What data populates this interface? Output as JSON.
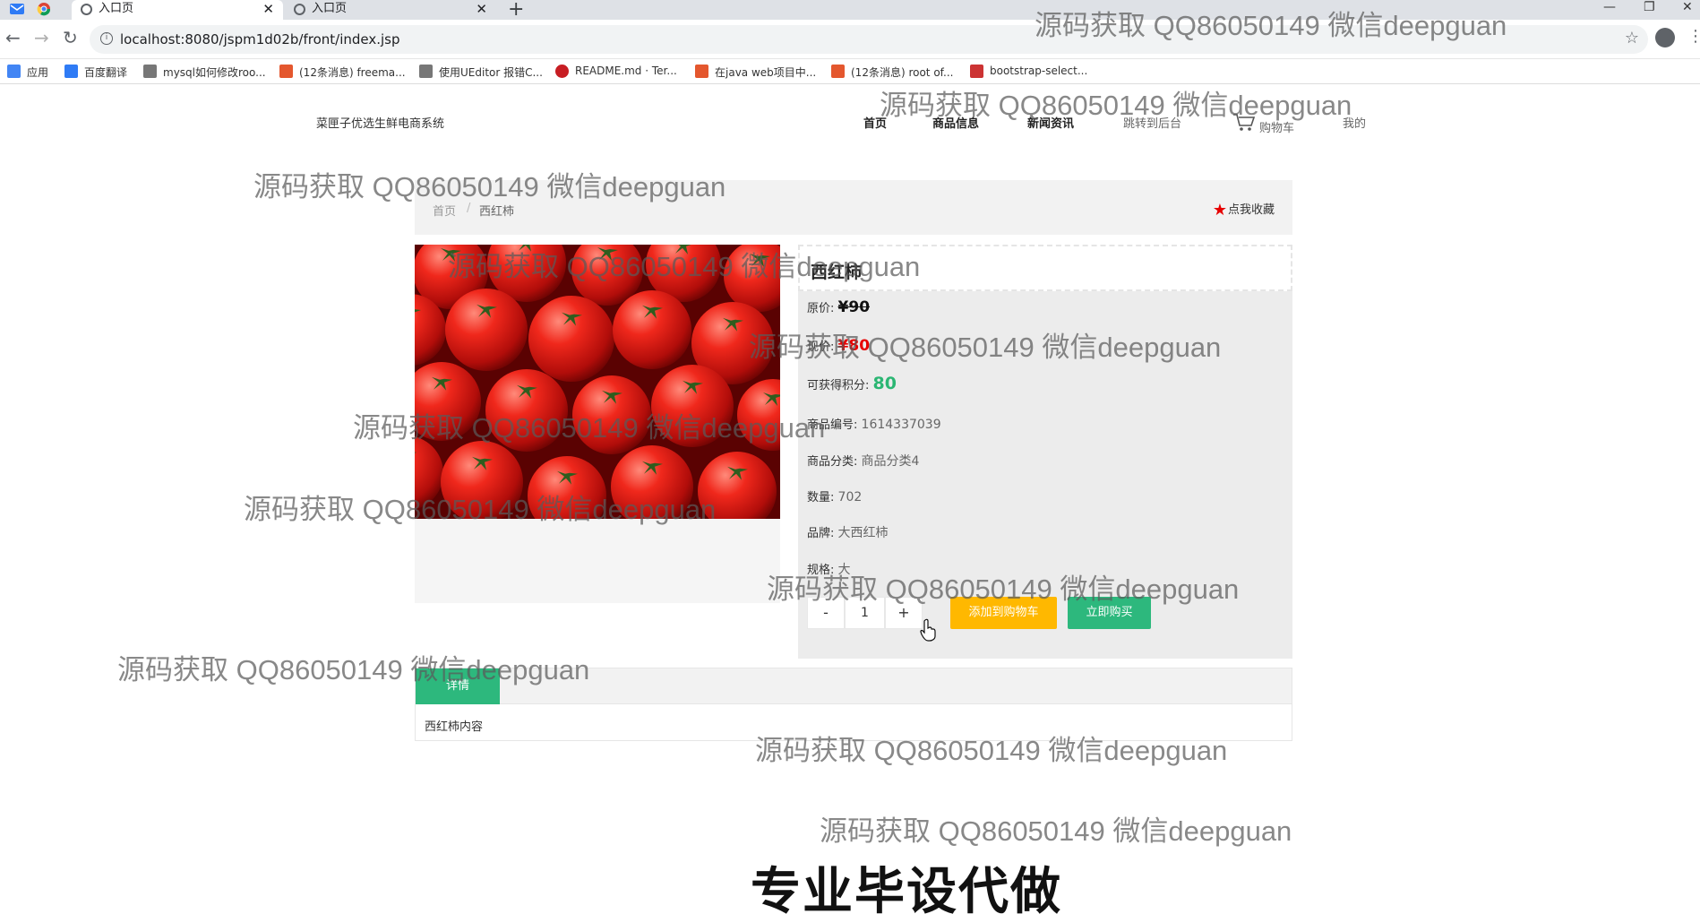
{
  "browser": {
    "tabs": [
      {
        "title": "入口页",
        "close": "✕"
      },
      {
        "title": "入口页",
        "close": "✕"
      }
    ],
    "new_tab": "+",
    "window_controls": {
      "minimize": "—",
      "restore": "❐",
      "close": "✕"
    },
    "url": "localhost:8080/jspm1d02b/front/index.jsp",
    "bookmarks": [
      {
        "label": "应用",
        "icon": "apps-grid-icon",
        "color": "#4285f4"
      },
      {
        "label": "百度翻译",
        "icon": "baidu-translate-icon",
        "color": "#2f7bf5"
      },
      {
        "label": "mysql如何修改roo...",
        "icon": "mysql-icon",
        "color": "#555555"
      },
      {
        "label": "(12条消息) freema...",
        "icon": "csdn-icon",
        "color": "#e4572e"
      },
      {
        "label": "使用UEditor 报错C...",
        "icon": "ueditor-icon",
        "color": "#555555"
      },
      {
        "label": "README.md · Ter...",
        "icon": "gitee-icon",
        "color": "#c71d23"
      },
      {
        "label": "在java web项目中...",
        "icon": "csdn-icon",
        "color": "#e4572e"
      },
      {
        "label": "(12条消息) root of...",
        "icon": "csdn-icon",
        "color": "#e4572e"
      },
      {
        "label": "bootstrap-select...",
        "icon": "bootstrap-icon",
        "color": "#cc3333"
      }
    ]
  },
  "site": {
    "title": "菜匣子优选生鲜电商系统",
    "nav": [
      "首页",
      "商品信息",
      "新闻资讯",
      "跳转到后台",
      "购物车",
      "我的"
    ]
  },
  "breadcrumb": {
    "home": "首页",
    "separator": "/",
    "current": "西红柿"
  },
  "favorite_label": "点我收藏",
  "product": {
    "name": "西红柿",
    "original_price_label": "原价:",
    "original_price": "¥90",
    "current_price_label": "现价:",
    "current_price": "¥80",
    "points_label": "可获得积分:",
    "points": "80",
    "code_label": "商品编号:",
    "code": "1614337039",
    "category_label": "商品分类:",
    "category": "商品分类4",
    "quantity_label": "数量:",
    "quantity": "702",
    "brand_label": "品牌:",
    "brand": "大西红柿",
    "spec_label": "规格:",
    "spec": "大"
  },
  "purchase": {
    "minus": "-",
    "qty": "1",
    "plus": "+",
    "add_to_cart": "添加到购物车",
    "buy_now": "立即购买"
  },
  "details": {
    "tab": "详情",
    "content": "西红柿内容"
  },
  "promo": "专业毕设代做",
  "watermark": "源码获取 QQ86050149 微信deepguan",
  "colors": {
    "accent_green": "#2db87d",
    "accent_yellow": "#ffb800",
    "price_red": "#e60000",
    "points_green": "#2bb673"
  }
}
